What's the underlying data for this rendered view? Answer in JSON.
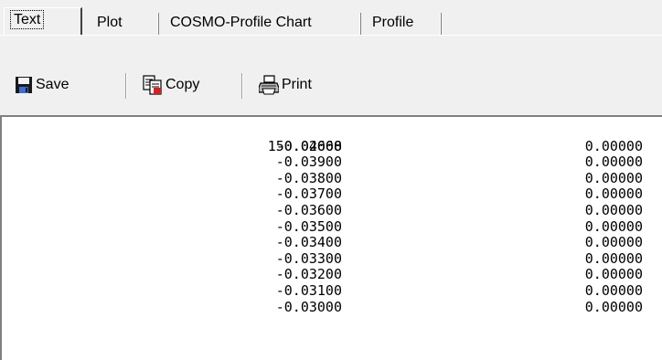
{
  "tabs": [
    {
      "label": "Text",
      "active": true
    },
    {
      "label": "Plot",
      "active": false
    },
    {
      "label": "COSMO-Profile Chart",
      "active": false
    },
    {
      "label": "Profile",
      "active": false
    }
  ],
  "toolbar": {
    "save_label": "Save",
    "copy_label": "Copy",
    "print_label": "Print"
  },
  "pane": {
    "header_value": "150.02668",
    "rows": [
      {
        "a": "-0.04000",
        "b": "0.00000"
      },
      {
        "a": "-0.03900",
        "b": "0.00000"
      },
      {
        "a": "-0.03800",
        "b": "0.00000"
      },
      {
        "a": "-0.03700",
        "b": "0.00000"
      },
      {
        "a": "-0.03600",
        "b": "0.00000"
      },
      {
        "a": "-0.03500",
        "b": "0.00000"
      },
      {
        "a": "-0.03400",
        "b": "0.00000"
      },
      {
        "a": "-0.03300",
        "b": "0.00000"
      },
      {
        "a": "-0.03200",
        "b": "0.00000"
      },
      {
        "a": "-0.03100",
        "b": "0.00000"
      },
      {
        "a": "-0.03000",
        "b": "0.00000"
      }
    ]
  }
}
